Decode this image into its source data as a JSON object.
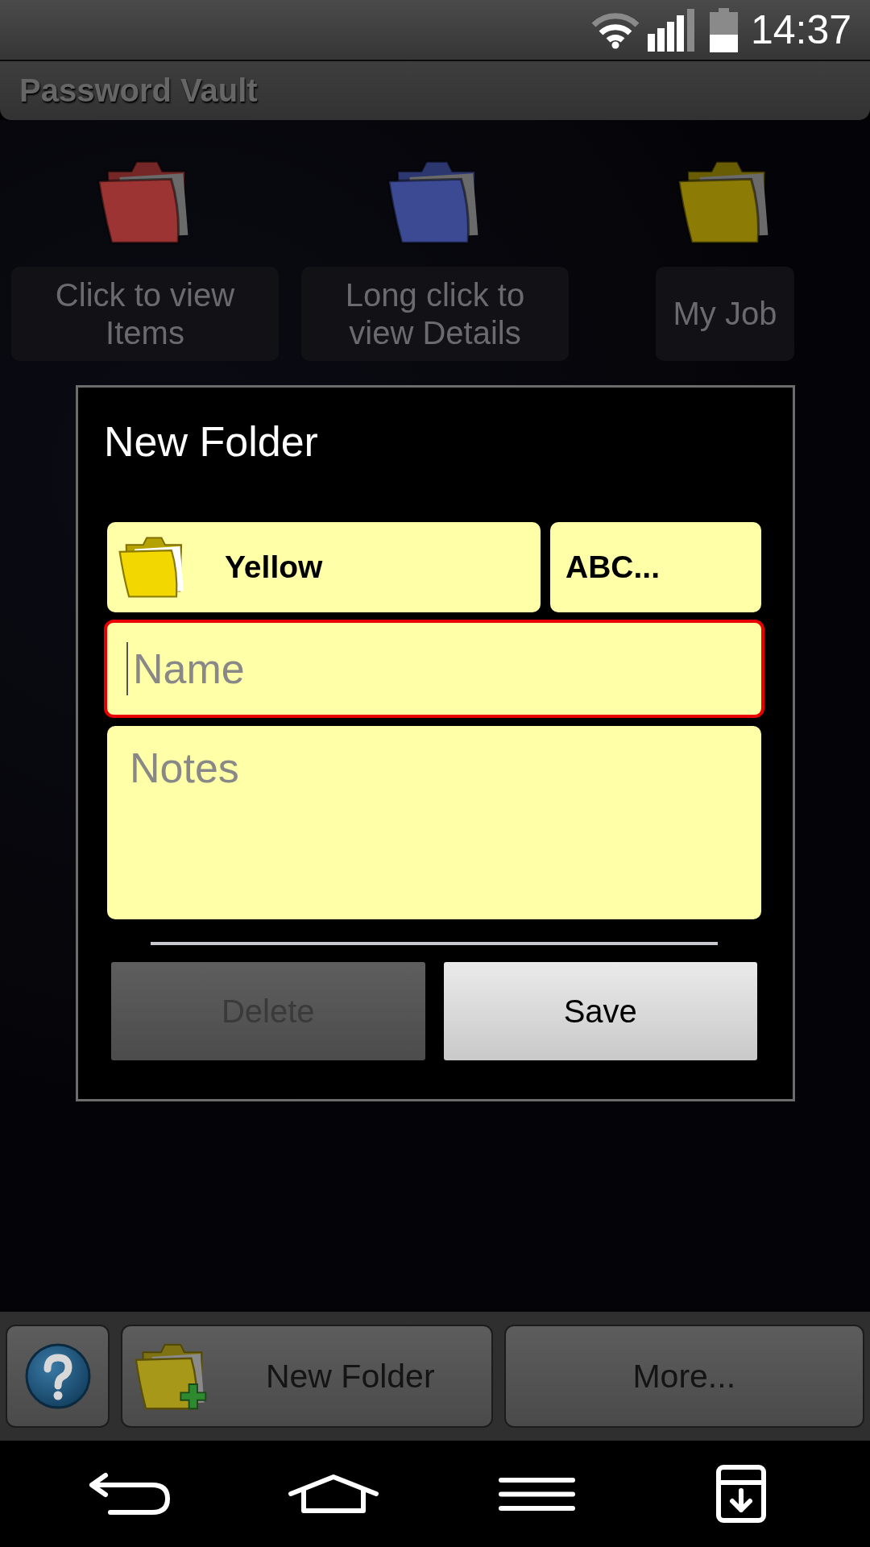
{
  "status_bar": {
    "time": "14:37"
  },
  "app_bar": {
    "title": "Password Vault"
  },
  "folders": [
    {
      "label": "Click to view Items",
      "color": "#9c3434"
    },
    {
      "label": "Long click to view Details",
      "color": "#3c4a94"
    },
    {
      "label": "My Job",
      "color": "#8c7c06"
    }
  ],
  "dialog": {
    "title": "New Folder",
    "color_button": {
      "label": "Yellow"
    },
    "sort_button": {
      "label": "ABC..."
    },
    "name_field": {
      "placeholder": "Name",
      "focused": true
    },
    "notes_field": {
      "placeholder": "Notes"
    },
    "buttons": [
      {
        "label": "Delete",
        "disabled": true
      },
      {
        "label": "Save",
        "disabled": false
      }
    ]
  },
  "toolbar": [
    {
      "kind": "help"
    },
    {
      "kind": "new_folder",
      "label": "New Folder"
    },
    {
      "kind": "more",
      "label": "More..."
    }
  ]
}
